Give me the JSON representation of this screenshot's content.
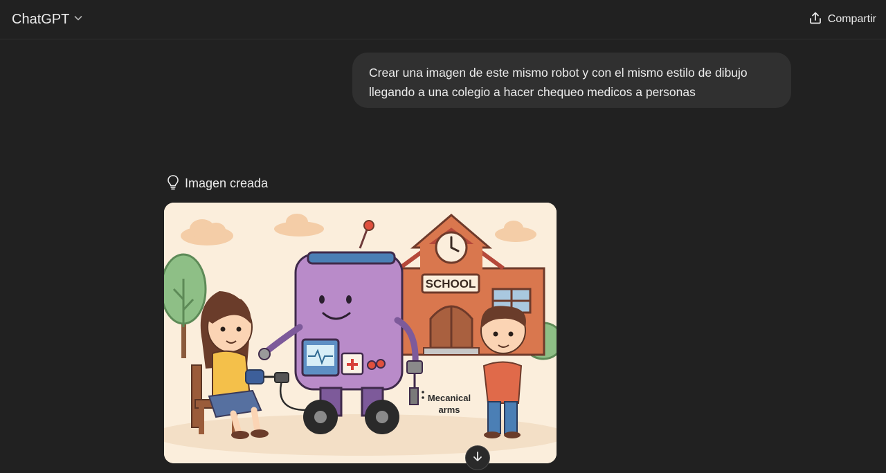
{
  "header": {
    "model_name": "ChatGPT",
    "share_label": "Compartir"
  },
  "conversation": {
    "user_message": "Crear una imagen de este mismo robot y con el mismo estilo de dibujo llegando a una colegio a hacer chequeo medicos a personas",
    "assistant": {
      "status_label": "Imagen creada",
      "image": {
        "sign_text": "SCHOOL",
        "annotation_line1": "Mecanical",
        "annotation_line2": "arms"
      }
    }
  },
  "icons": {
    "model_chevron": "chevron-down-icon",
    "share": "share-upload-icon",
    "status": "lightbulb-icon",
    "scroll": "arrow-down-icon"
  }
}
